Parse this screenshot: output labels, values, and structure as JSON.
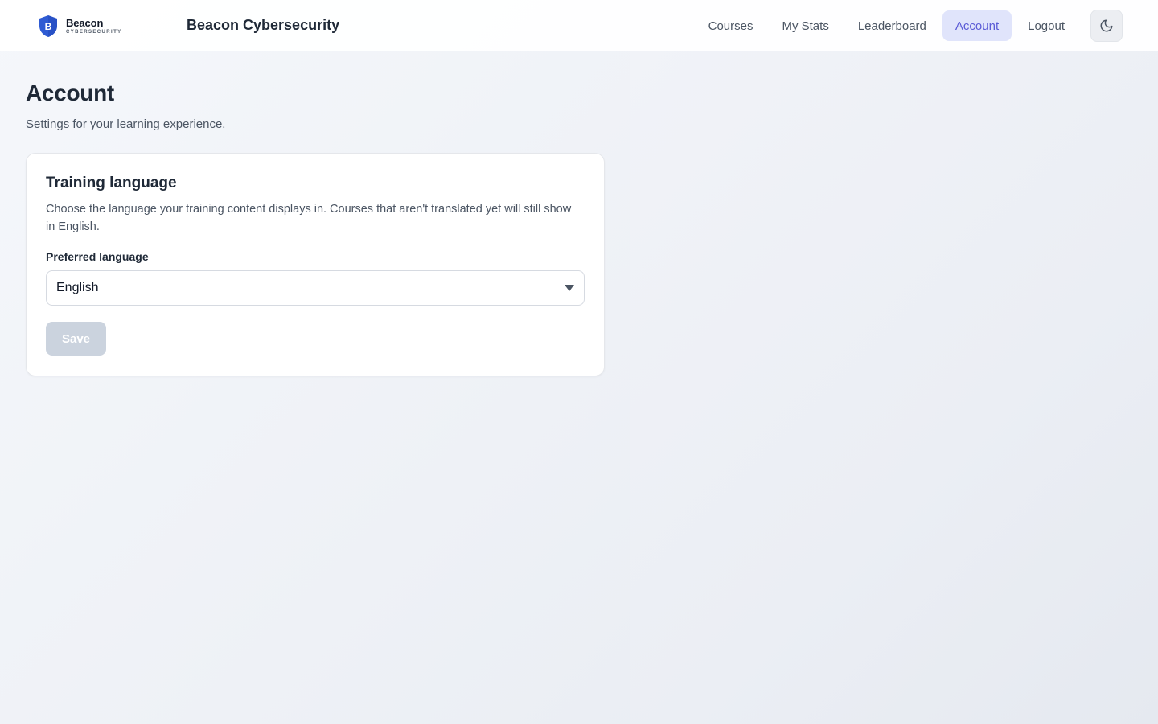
{
  "brand": {
    "logo_name": "Beacon",
    "logo_sub": "CYBERSECURITY",
    "logo_letter": "B",
    "app_title": "Beacon Cybersecurity",
    "accent_color": "#5b5bd6",
    "shield_color": "#2f5bd3"
  },
  "nav": {
    "items": [
      {
        "label": "Courses",
        "active": false
      },
      {
        "label": "My Stats",
        "active": false
      },
      {
        "label": "Leaderboard",
        "active": false
      },
      {
        "label": "Account",
        "active": true
      },
      {
        "label": "Logout",
        "active": false
      }
    ],
    "theme_toggle_icon": "moon-icon"
  },
  "page": {
    "title": "Account",
    "subtitle": "Settings for your learning experience."
  },
  "language_card": {
    "title": "Training language",
    "description": "Choose the language your training content displays in. Courses that aren't translated yet will still show in English.",
    "field_label": "Preferred language",
    "selected_value": "English",
    "save_label": "Save",
    "save_disabled": true
  }
}
